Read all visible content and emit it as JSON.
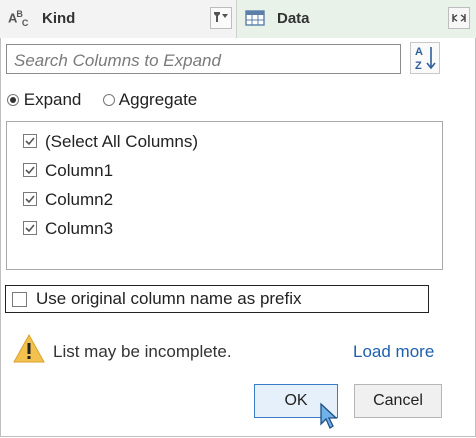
{
  "header": {
    "type_icon_main": "A",
    "type_icon_sup": "B",
    "type_icon_sub": "C",
    "kind_label": "Kind",
    "data_label": "Data"
  },
  "panel": {
    "search_placeholder": "Search Columns to Expand",
    "sort_icon": "az-sort-icon",
    "mode": {
      "expand_label": "Expand",
      "aggregate_label": "Aggregate",
      "selected": "Expand"
    },
    "columns": [
      {
        "label": "(Select All Columns)",
        "checked": true
      },
      {
        "label": "Column1",
        "checked": true
      },
      {
        "label": "Column2",
        "checked": true
      },
      {
        "label": "Column3",
        "checked": true
      }
    ],
    "prefix_label": "Use original column name as prefix",
    "prefix_checked": false,
    "warning_text": "List may be incomplete.",
    "load_more": "Load more",
    "ok_label": "OK",
    "cancel_label": "Cancel"
  },
  "colors": {
    "accent": "#3a7cc8",
    "link": "#1f5fae",
    "warning": "#f2c14e",
    "data_header_bg": "#e9f2e9"
  }
}
